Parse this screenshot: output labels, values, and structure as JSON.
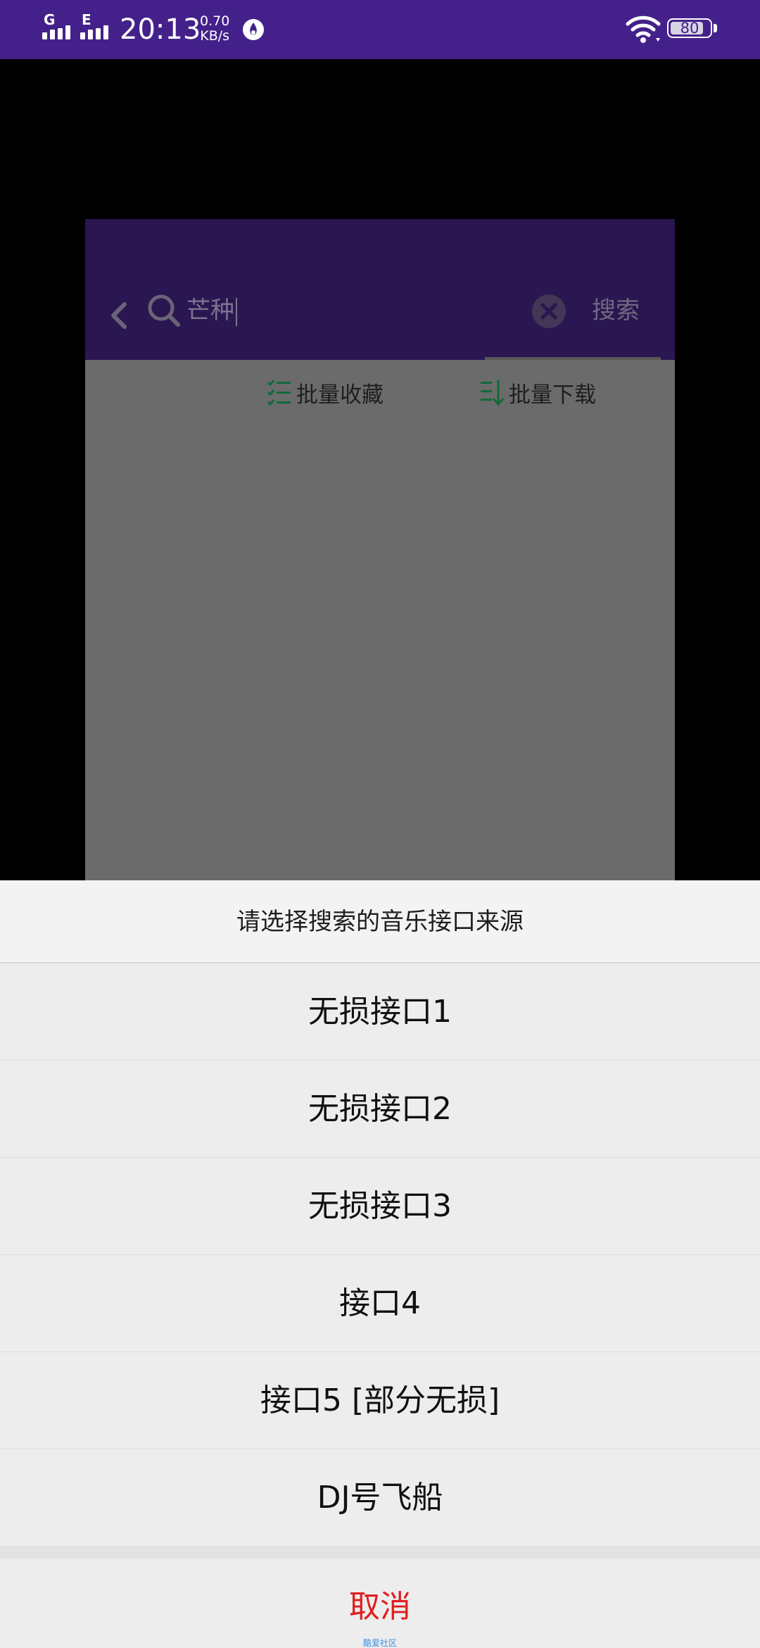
{
  "status_bar": {
    "sim1_type": "G",
    "sim2_type": "E",
    "time": "20:13",
    "net_speed_value": "0.70",
    "net_speed_unit": "KB/s",
    "battery_level": "80",
    "icons": [
      "signal-icon",
      "signal-icon",
      "location-icon",
      "wifi-icon",
      "battery-icon"
    ]
  },
  "app": {
    "search_query": "芒种",
    "search_button_label": "搜索",
    "toolbar": {
      "batch_favorite_label": "批量收藏",
      "batch_download_label": "批量下载"
    },
    "colors": {
      "header": "#2a1650",
      "accent": "#0f6b3a"
    }
  },
  "action_sheet": {
    "title": "请选择搜索的音乐接口来源",
    "options": [
      {
        "label": "无损接口1"
      },
      {
        "label": "无损接口2"
      },
      {
        "label": "无损接口3"
      },
      {
        "label": "接口4"
      },
      {
        "label": "接口5 [部分无损]"
      },
      {
        "label": "DJ号飞船"
      }
    ],
    "cancel_label": "取消",
    "watermark": "酷爱社区",
    "colors": {
      "cancel": "#e01e1e"
    }
  }
}
